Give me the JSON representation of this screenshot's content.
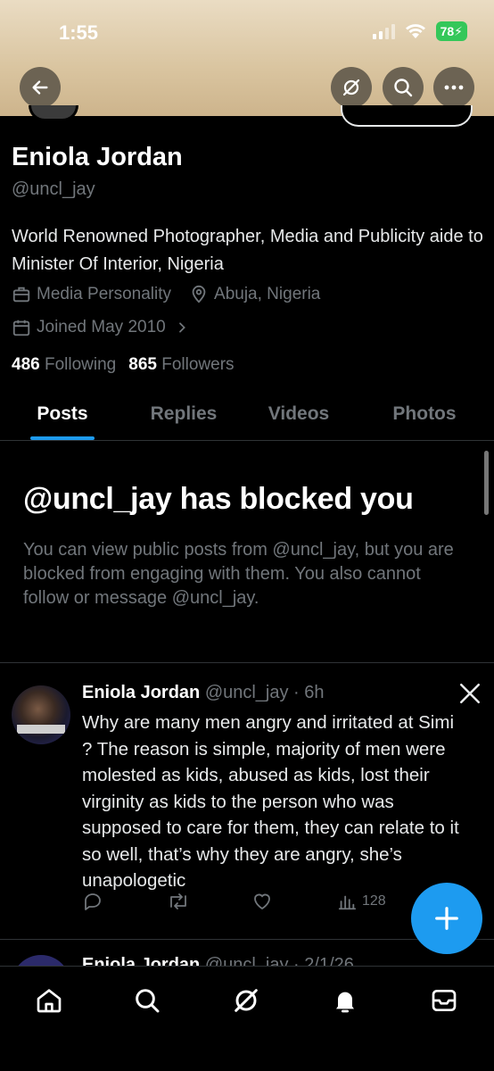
{
  "status_bar": {
    "time": "1:55",
    "battery": "78"
  },
  "header": {
    "back_icon": "arrow-left-icon",
    "grok_icon": "grok-icon",
    "search_icon": "search-icon",
    "more_icon": "more-icon"
  },
  "profile": {
    "name": "Eniola Jordan",
    "handle": "@uncl_jay",
    "bio": "World Renowned Photographer, Media and Publicity aide to Minister Of Interior, Nigeria",
    "category": "Media Personality",
    "location": "Abuja, Nigeria",
    "joined": "Joined May 2010",
    "following_count": "486",
    "following_label": "Following",
    "followers_count": "865",
    "followers_label": "Followers"
  },
  "tabs": [
    {
      "label": "Posts",
      "active": true
    },
    {
      "label": "Replies",
      "active": false
    },
    {
      "label": "Videos",
      "active": false
    },
    {
      "label": "Photos",
      "active": false
    }
  ],
  "blocked": {
    "title": "@uncl_jay has blocked you",
    "description": "You can view public posts from @uncl_jay, but you are blocked from engaging with them. You also cannot follow or message @uncl_jay."
  },
  "posts": [
    {
      "author": "Eniola Jordan",
      "handle": "@uncl_jay",
      "time": "6h",
      "text": "Why are many men angry and irritated at Simi ? The reason is simple, majority of men were molested as kids, abused as kids, lost their virginity as kids to the person who was supposed to care for them, they can relate to it so well, that’s why they are angry, she’s unapologetic",
      "views": "128"
    },
    {
      "author": "Eniola Jordan",
      "handle": "@uncl_jay",
      "time": "2/1/26"
    }
  ],
  "fab": {
    "icon": "plus-icon"
  },
  "accent_color": "#1d9bf0",
  "nav": [
    "home-icon",
    "search-icon",
    "grok-icon",
    "notifications-icon",
    "messages-icon"
  ]
}
